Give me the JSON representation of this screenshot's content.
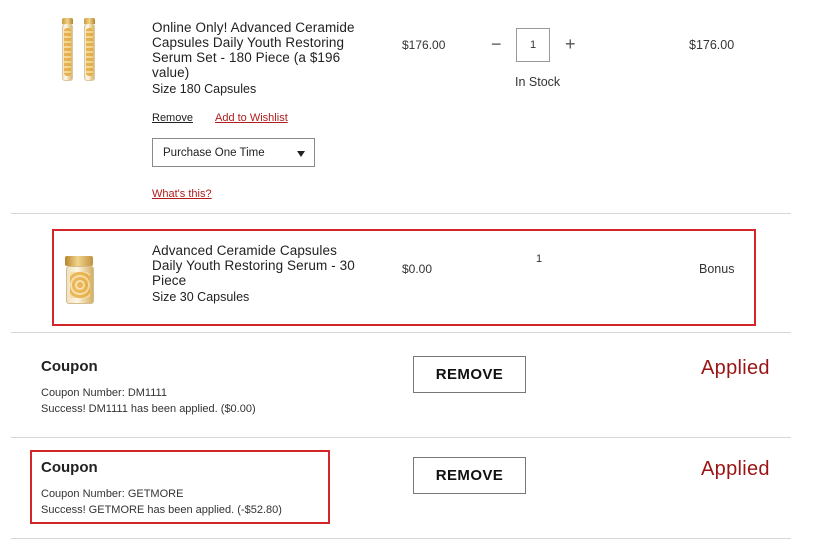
{
  "item1": {
    "name": "Online Only! Advanced Ceramide Capsules Daily Youth Restoring Serum Set - 180 Piece (a $196 value)",
    "size": "Size 180 Capsules",
    "price": "$176.00",
    "quantity": "1",
    "stock": "In Stock",
    "total": "$176.00",
    "remove_label": "Remove",
    "wishlist_label": "Add to Wishlist",
    "purchase_option": "Purchase One Time",
    "whats_this": "What's this?",
    "qty_minus": "−",
    "qty_plus": "+"
  },
  "item2": {
    "name": "Advanced Ceramide Capsules Daily Youth Restoring Serum - 30 Piece",
    "size": "Size 30 Capsules",
    "price": "$0.00",
    "quantity": "1",
    "total": "Bonus"
  },
  "coupons": [
    {
      "title": "Coupon",
      "number_line": "Coupon Number: DM1111",
      "message": "Success! DM1111 has been applied. ($0.00)",
      "remove_label": "REMOVE",
      "status": "Applied"
    },
    {
      "title": "Coupon",
      "number_line": "Coupon Number: GETMORE",
      "message": "Success! GETMORE has been applied. (-$52.80)",
      "remove_label": "REMOVE",
      "status": "Applied"
    }
  ],
  "colors": {
    "accent_red": "#b01c1c",
    "applied_red": "#9b1414",
    "highlight_red": "#d3262b"
  }
}
